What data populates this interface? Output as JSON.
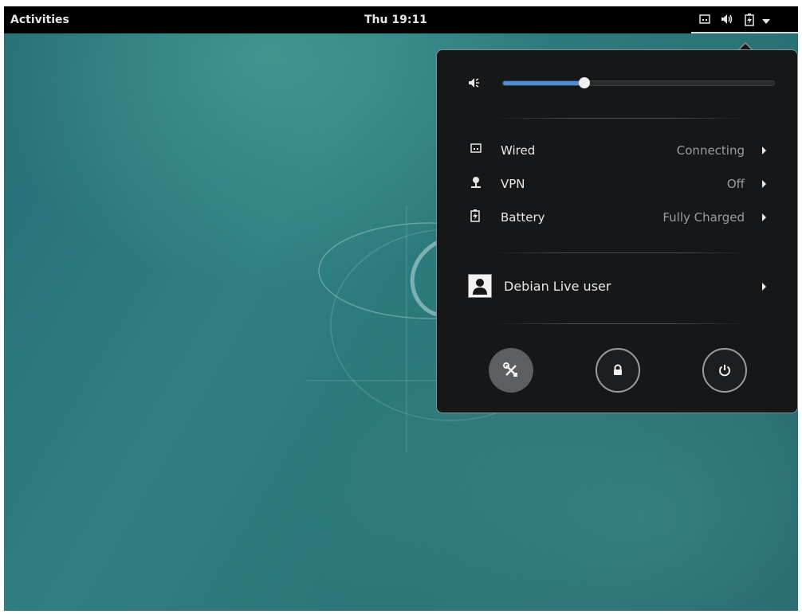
{
  "topbar": {
    "activities": "Activities",
    "clock": "Thu 19:11",
    "tray_icons": [
      "network-wired-icon",
      "speaker-volume-icon",
      "battery-charging-icon",
      "dropdown-arrow-icon"
    ]
  },
  "system_menu": {
    "volume": {
      "icon": "speaker-volume-icon",
      "level": 0.3,
      "accent_color": "#4a90d9"
    },
    "items": [
      {
        "icon": "network-wired-icon",
        "label": "Wired",
        "status": "Connecting"
      },
      {
        "icon": "vpn-icon",
        "label": "VPN",
        "status": "Off"
      },
      {
        "icon": "battery-charging-icon",
        "label": "Battery",
        "status": "Fully Charged"
      }
    ],
    "user": {
      "icon": "user-avatar-icon",
      "name": "Debian Live user"
    },
    "actions": [
      "settings-icon",
      "lock-icon",
      "power-icon"
    ]
  }
}
